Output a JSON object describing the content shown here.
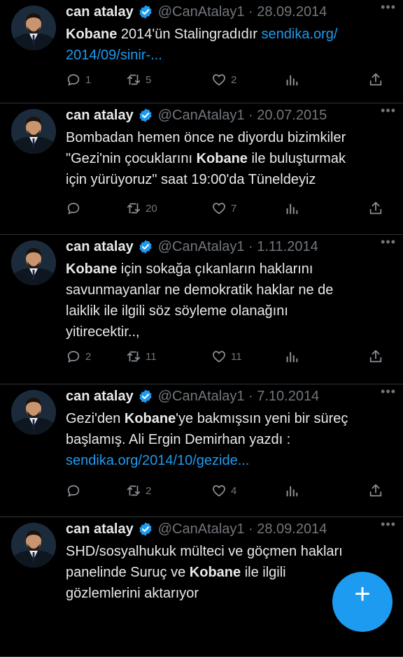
{
  "accent_color": "#1d9bf0",
  "tweets": [
    {
      "name": "can atalay",
      "handle": "@CanAtalay1 · 28.09.2014",
      "lines": [
        [
          {
            "t": "Kobane",
            "b": true
          },
          {
            "t": " 2014'ün Stalingradıdır "
          },
          {
            "t": "sendika.org/",
            "link": true
          }
        ],
        [
          {
            "t": "2014/09/sinir-...",
            "link": true
          }
        ]
      ],
      "replies": "1",
      "retweets": "5",
      "likes": "2"
    },
    {
      "name": "can atalay",
      "handle": "@CanAtalay1 · 20.07.2015",
      "lines": [
        [
          {
            "t": "Bombadan hemen önce ne diyordu bizimkiler"
          }
        ],
        [
          {
            "t": "\"Gezi'nin çocuklarını "
          },
          {
            "t": "Kobane",
            "b": true
          },
          {
            "t": " ile buluşturmak"
          }
        ],
        [
          {
            "t": "için yürüyoruz\" saat 19:00'da Tüneldeyiz"
          }
        ]
      ],
      "replies": "",
      "retweets": "20",
      "likes": "7"
    },
    {
      "name": "can atalay",
      "handle": "@CanAtalay1 · 1.11.2014",
      "lines": [
        [
          {
            "t": "Kobane",
            "b": true
          },
          {
            "t": " için sokağa çıkanların haklarını"
          }
        ],
        [
          {
            "t": "savunmayanlar ne demokratik haklar ne de"
          }
        ],
        [
          {
            "t": "laiklik ile ilgili söz söyleme olanağını"
          }
        ],
        [
          {
            "t": "yitirecektir..,"
          }
        ]
      ],
      "replies": "2",
      "retweets": "11",
      "likes": "11"
    },
    {
      "name": "can atalay",
      "handle": "@CanAtalay1 · 7.10.2014",
      "lines": [
        [
          {
            "t": "Gezi'den "
          },
          {
            "t": "Kobane",
            "b": true
          },
          {
            "t": "'ye bakmışsın yeni bir süreç"
          }
        ],
        [
          {
            "t": "başlamış. Ali Ergin Demirhan yazdı :"
          }
        ],
        [
          {
            "t": "sendika.org/2014/10/gezide...",
            "link": true
          }
        ]
      ],
      "replies": "",
      "retweets": "2",
      "likes": "4"
    },
    {
      "name": "can atalay",
      "handle": "@CanAtalay1 · 28.09.2014",
      "lines": [
        [
          {
            "t": "SHD/sosyalhukuk mülteci ve göçmen hakları"
          }
        ],
        [
          {
            "t": "panelinde Suruç ve "
          },
          {
            "t": "Kobane",
            "b": true
          },
          {
            "t": " ile ilgili"
          }
        ],
        [
          {
            "t": "gözlemlerini aktarıyor"
          }
        ]
      ],
      "replies": "",
      "retweets": "",
      "likes": ""
    }
  ],
  "more_label": "•••",
  "fab_label": "+"
}
